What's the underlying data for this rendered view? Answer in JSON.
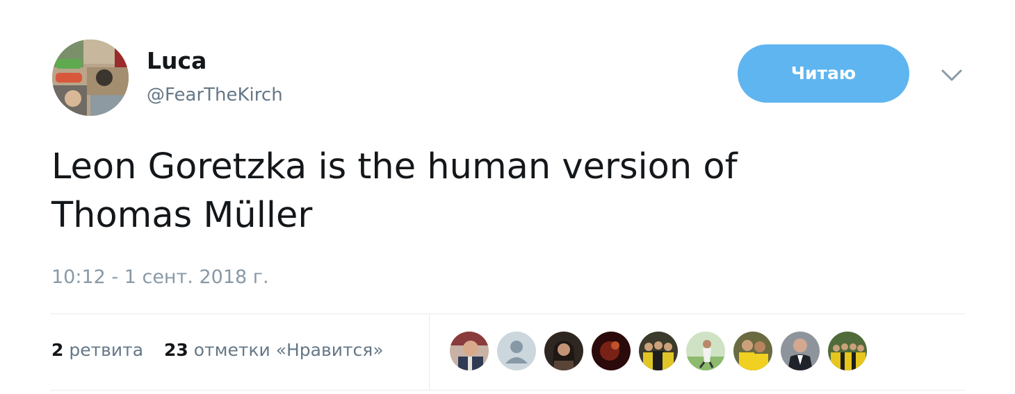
{
  "author": {
    "display_name": "Luca",
    "handle": "@FearTheKirch"
  },
  "follow_button_label": "Читаю",
  "tweet": {
    "text_line1": "Leon Goretzka is the human version of",
    "text_line2": "Thomas Müller",
    "timestamp": "10:12 - 1 сент. 2018 г."
  },
  "stats": {
    "retweets_count": "2",
    "retweets_label": "ретвита",
    "likes_count": "23",
    "likes_label": "отметки «Нравится»"
  },
  "likers": [
    {
      "icon": "liker-avatar-man-photo-icon"
    },
    {
      "icon": "default-profile-icon"
    },
    {
      "icon": "liker-avatar-woman-photo-icon"
    },
    {
      "icon": "liker-avatar-dark-photo-icon"
    },
    {
      "icon": "liker-avatar-team-photo-icon"
    },
    {
      "icon": "liker-avatar-player-photo-icon"
    },
    {
      "icon": "liker-avatar-yellow-kit-photo-icon"
    },
    {
      "icon": "liker-avatar-suit-photo-icon"
    },
    {
      "icon": "liker-avatar-group-photo-icon"
    }
  ],
  "colors": {
    "follow_button": "#5eb5ef",
    "secondary_text": "#657786",
    "timestamp_text": "#8899a6",
    "divider": "#e6ecf0"
  }
}
